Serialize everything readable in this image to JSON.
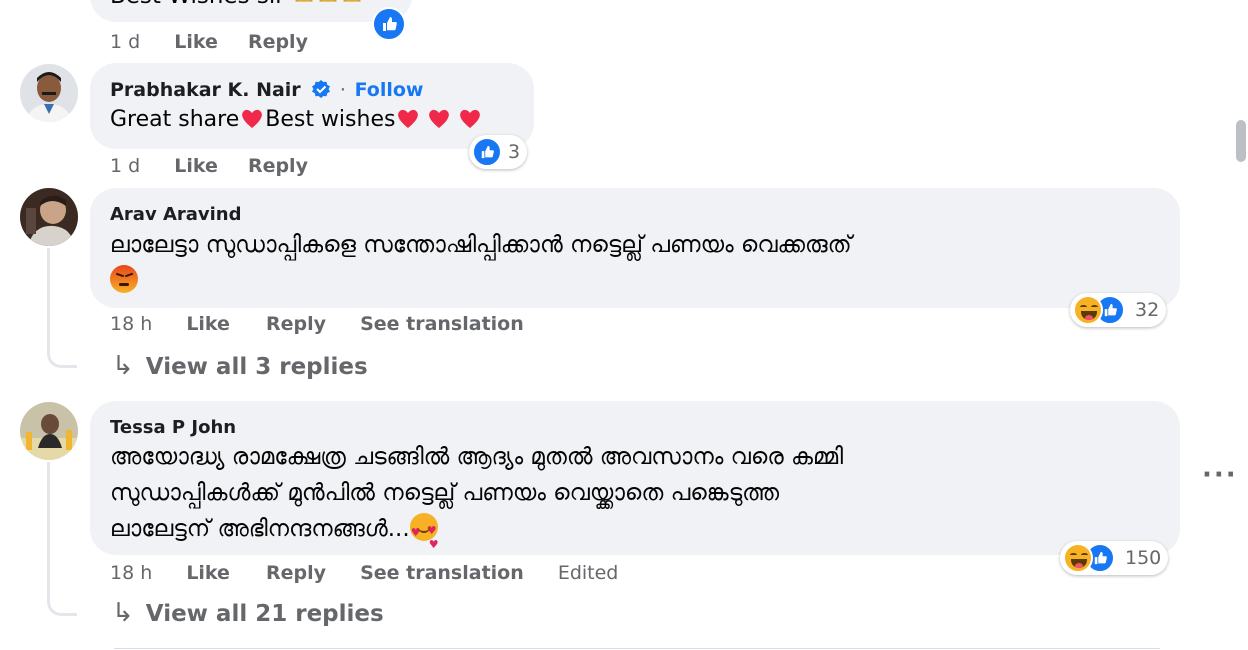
{
  "top_comment": {
    "text": "Best Wishes sir",
    "time": "1 d",
    "like": "Like",
    "reply": "Reply"
  },
  "comments": [
    {
      "author": "Prabhakar K. Nair",
      "separator": "·",
      "follow": "Follow",
      "text_1": "Great share",
      "text_2": "Best wishes",
      "time": "1 d",
      "like": "Like",
      "reply": "Reply",
      "reaction_count": "3"
    },
    {
      "author": "Arav Aravind",
      "text": "ലാലേട്ടാ സുഡാപ്പികളെ സന്തോഷിപ്പിക്കാൻ നട്ടെല്ല് പണയം വെക്കരുത്",
      "time": "18 h",
      "like": "Like",
      "reply": "Reply",
      "translate": "See translation",
      "reaction_count": "32",
      "view_replies": "View all 3 replies"
    },
    {
      "author": "Tessa P John",
      "text_line_1": "അയോദ്ധ്യ രാമക്ഷേത്ര ചടങ്ങിൽ ആദ്യം മുതൽ അവസാനം വരെ കമ്മി",
      "text_line_2": "സുഡാപ്പികൾക്ക് മുൻപിൽ നട്ടെല്ല് പണയം വെയ്ക്കാതെ പങ്കെടുത്ത",
      "text_line_3": "ലാലേട്ടന് അഭിനന്ദനങ്ങൾ...",
      "time": "18 h",
      "like": "Like",
      "reply": "Reply",
      "translate": "See translation",
      "edited": "Edited",
      "reaction_count": "150",
      "view_replies": "View all 21 replies"
    }
  ],
  "icons": {
    "like": "thumbs-up-icon",
    "haha": "haha-emoji-icon",
    "heart": "red-heart-icon",
    "angry": "angry-emoji-icon",
    "inlove": "smiling-face-with-hearts-icon",
    "verified": "verified-badge-icon",
    "more": "more-options-icon",
    "reply_arrow": "reply-arrow-icon"
  },
  "colors": {
    "bubble": "#f0f2f5",
    "link_blue": "#1877f2",
    "meta_gray": "#65676b",
    "heart_red": "#f02849"
  }
}
